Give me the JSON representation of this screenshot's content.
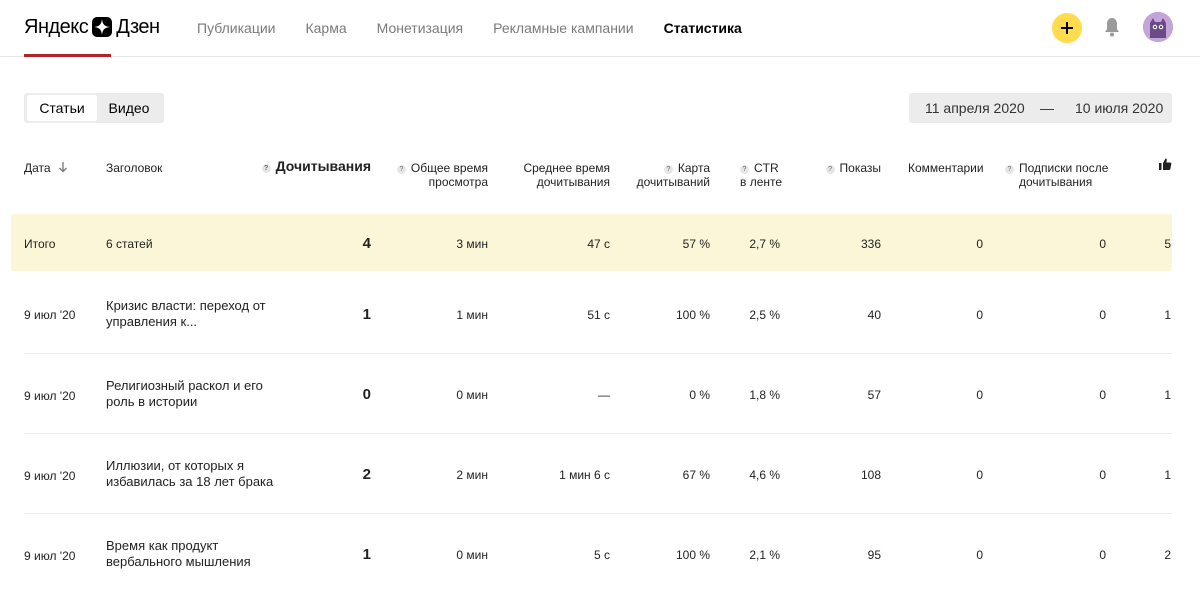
{
  "header": {
    "logo_left": "Яндекс",
    "logo_right": "Дзен",
    "nav": [
      "Публикации",
      "Карма",
      "Монетизация",
      "Рекламные кампании",
      "Статистика"
    ],
    "active_nav": "Статистика"
  },
  "tabs": [
    "Статьи",
    "Видео"
  ],
  "selected_tab": "Статьи",
  "date_range": {
    "from": "11 апреля 2020",
    "dash": "—",
    "to": "10 июля 2020"
  },
  "columns": {
    "date": "Дата",
    "title": "Заголовок",
    "reads": "Дочитывания",
    "total_time_1": "Общее время",
    "total_time_2": "просмотра",
    "avg_time_1": "Среднее время",
    "avg_time_2": "дочитывания",
    "map_1": "Карта",
    "map_2": "дочитываний",
    "ctr_1": "CTR",
    "ctr_2": "в ленте",
    "views": "Показы",
    "comments": "Комментарии",
    "subs_1": "Подписки после",
    "subs_2": "дочитывания",
    "q": "?"
  },
  "total": {
    "label": "Итого",
    "title": "6 статей",
    "reads": "4",
    "total_time": "3 мин",
    "avg_time": "47 с",
    "map": "57 %",
    "ctr": "2,7 %",
    "views": "336",
    "comments": "0",
    "subs": "0",
    "likes": "5"
  },
  "rows": [
    {
      "date": "9 июл '20",
      "title": "Кризис власти: переход от управления к...",
      "reads": "1",
      "total_time": "1 мин",
      "avg_time": "51 с",
      "map": "100 %",
      "ctr": "2,5 %",
      "views": "40",
      "comments": "0",
      "subs": "0",
      "likes": "1"
    },
    {
      "date": "9 июл '20",
      "title": "Религиозный раскол и его роль в истории",
      "reads": "0",
      "total_time": "0 мин",
      "avg_time": "—",
      "map": "0 %",
      "ctr": "1,8 %",
      "views": "57",
      "comments": "0",
      "subs": "0",
      "likes": "1"
    },
    {
      "date": "9 июл '20",
      "title": "Иллюзии, от которых я избавилась за 18 лет брака",
      "reads": "2",
      "total_time": "2 мин",
      "avg_time": "1 мин 6 с",
      "map": "67 %",
      "ctr": "4,6 %",
      "views": "108",
      "comments": "0",
      "subs": "0",
      "likes": "1"
    },
    {
      "date": "9 июл '20",
      "title": "Время как продукт вербального мышления",
      "reads": "1",
      "total_time": "0 мин",
      "avg_time": "5 с",
      "map": "100 %",
      "ctr": "2,1 %",
      "views": "95",
      "comments": "0",
      "subs": "0",
      "likes": "2"
    }
  ]
}
